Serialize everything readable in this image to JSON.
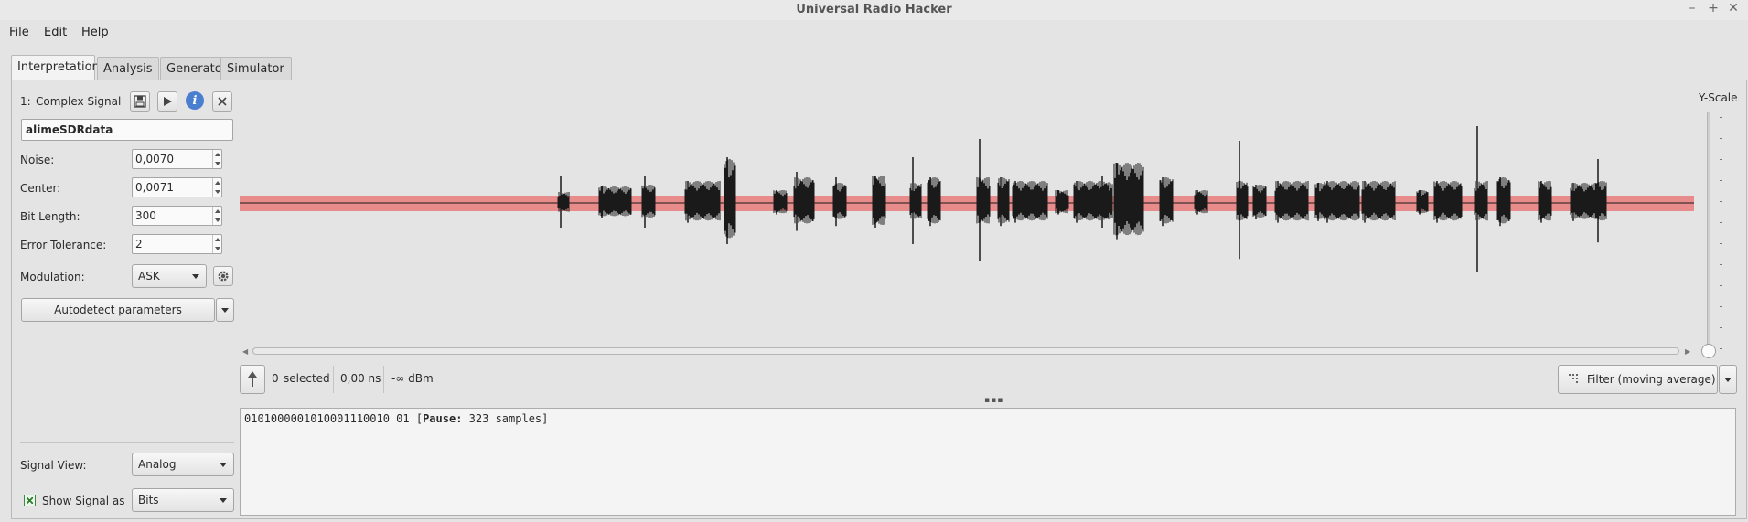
{
  "window": {
    "title": "Universal Radio Hacker",
    "controls": [
      "–",
      "+",
      "✕"
    ]
  },
  "menu": [
    "File",
    "Edit",
    "Help"
  ],
  "tabs": [
    "Interpretation",
    "Analysis",
    "Generator",
    "Simulator"
  ],
  "signal": {
    "index": "1:",
    "type": "Complex Signal",
    "name": "alimeSDRdata",
    "icons": [
      "save-icon",
      "play-icon",
      "info-icon",
      "close-icon"
    ]
  },
  "params": {
    "noise_label": "Noise:",
    "noise": "0,0070",
    "center_label": "Center:",
    "center": "0,0071",
    "bitlen_label": "Bit Length:",
    "bitlen": "300",
    "errtol_label": "Error Tolerance:",
    "errtol": "2",
    "modulation_label": "Modulation:",
    "modulation": "ASK",
    "autodetect": "Autodetect parameters"
  },
  "view": {
    "signal_view_label": "Signal View:",
    "signal_view": "Analog",
    "show_signal_label": "Show Signal as",
    "show_as": "Bits"
  },
  "plot": {
    "yscale_label": "Y-Scale",
    "noise_band_color": "#e88b8b",
    "signal_color": "#1a1a1a"
  },
  "status": {
    "selected_count": "0",
    "selected_label": "selected",
    "duration": "0,00 ns",
    "power": "-∞ dBm",
    "filter_button": "Filter (moving average)"
  },
  "output": {
    "bits": "0101000001010001110010 01",
    "pause_label": "Pause:",
    "pause_value": "323 samples"
  }
}
